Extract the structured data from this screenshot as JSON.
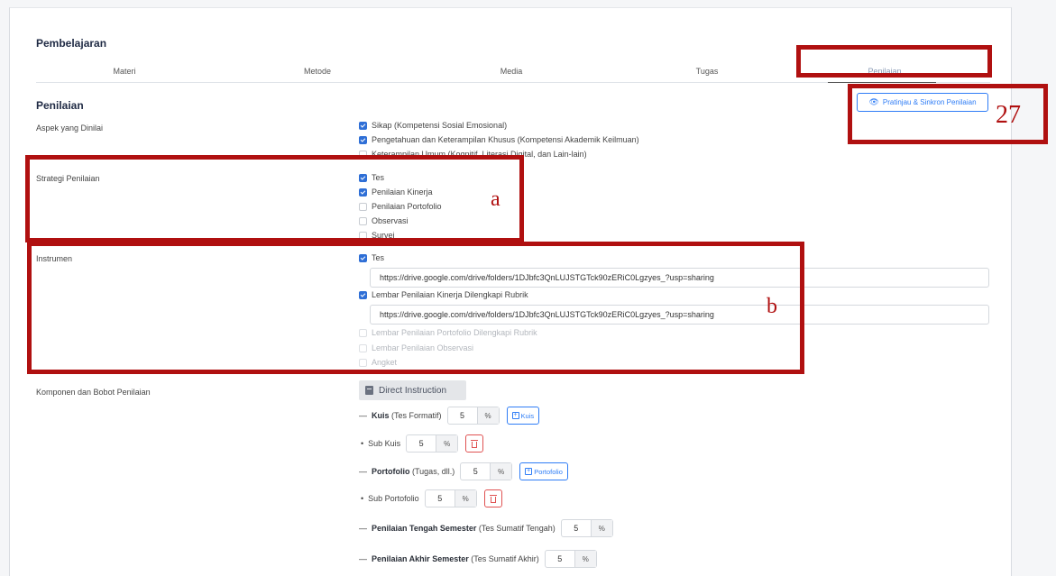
{
  "section_title": "Pembelajaran",
  "tabs": [
    {
      "label": "Materi",
      "active": false
    },
    {
      "label": "Metode",
      "active": false
    },
    {
      "label": "Media",
      "active": false
    },
    {
      "label": "Tugas",
      "active": false
    },
    {
      "label": "Penilaian",
      "active": true
    }
  ],
  "penilaian_title": "Penilaian",
  "preview_button": "Pratinjau & Sinkron Penilaian",
  "aspek": {
    "label": "Aspek yang Dinilai",
    "options": [
      {
        "label": "Sikap (Kompetensi Sosial Emosional)",
        "checked": true
      },
      {
        "label": "Pengetahuan dan Keterampilan Khusus (Kompetensi Akademik Keilmuan)",
        "checked": true
      },
      {
        "label": "Keterampilan Umum (Kognitif, Literasi Digital, dan Lain-lain)",
        "checked": false
      }
    ]
  },
  "strategi": {
    "label": "Strategi Penilaian",
    "options": [
      {
        "label": "Tes",
        "checked": true
      },
      {
        "label": "Penilaian Kinerja",
        "checked": true
      },
      {
        "label": "Penilaian Portofolio",
        "checked": false
      },
      {
        "label": "Observasi",
        "checked": false
      },
      {
        "label": "Survei",
        "checked": false
      }
    ]
  },
  "instrumen": {
    "label": "Instrumen",
    "options": [
      {
        "label": "Tes",
        "checked": true,
        "disabled": false,
        "url": "https://drive.google.com/drive/folders/1DJbfc3QnLUJSTGTck90zERiC0Lgzyes_?usp=sharing"
      },
      {
        "label": "Lembar Penilaian Kinerja Dilengkapi Rubrik",
        "checked": true,
        "disabled": false,
        "url": "https://drive.google.com/drive/folders/1DJbfc3QnLUJSTGTck90zERiC0Lgzyes_?usp=sharing"
      },
      {
        "label": "Lembar Penilaian Portofolio Dilengkapi Rubrik",
        "checked": false,
        "disabled": true
      },
      {
        "label": "Lembar Penilaian Observasi",
        "checked": false,
        "disabled": true
      },
      {
        "label": "Angket",
        "checked": false,
        "disabled": true
      }
    ]
  },
  "komponen": {
    "label": "Komponen dan Bobot Penilaian",
    "model_button": "Direct Instruction",
    "unit": "%",
    "kuis": {
      "name": "Kuis",
      "note": "(Tes Formatif)",
      "value": "5",
      "add_label": "Kuis"
    },
    "sub_kuis": {
      "name": "Sub Kuis",
      "value": "5"
    },
    "portofolio": {
      "name": "Portofolio",
      "note": "(Tugas, dll.)",
      "value": "5",
      "add_label": "Portofolio"
    },
    "sub_portofolio": {
      "name": "Sub Portofolio",
      "value": "5"
    },
    "pts": {
      "name": "Penilaian Tengah Semester",
      "note": "(Tes Sumatif Tengah)",
      "value": "5"
    },
    "pas": {
      "name": "Penilaian Akhir Semester",
      "note": "(Tes Sumatif Akhir)",
      "value": "5"
    }
  },
  "annotations": {
    "a": "a",
    "b": "b",
    "page": "27",
    "color": "#b01010"
  }
}
